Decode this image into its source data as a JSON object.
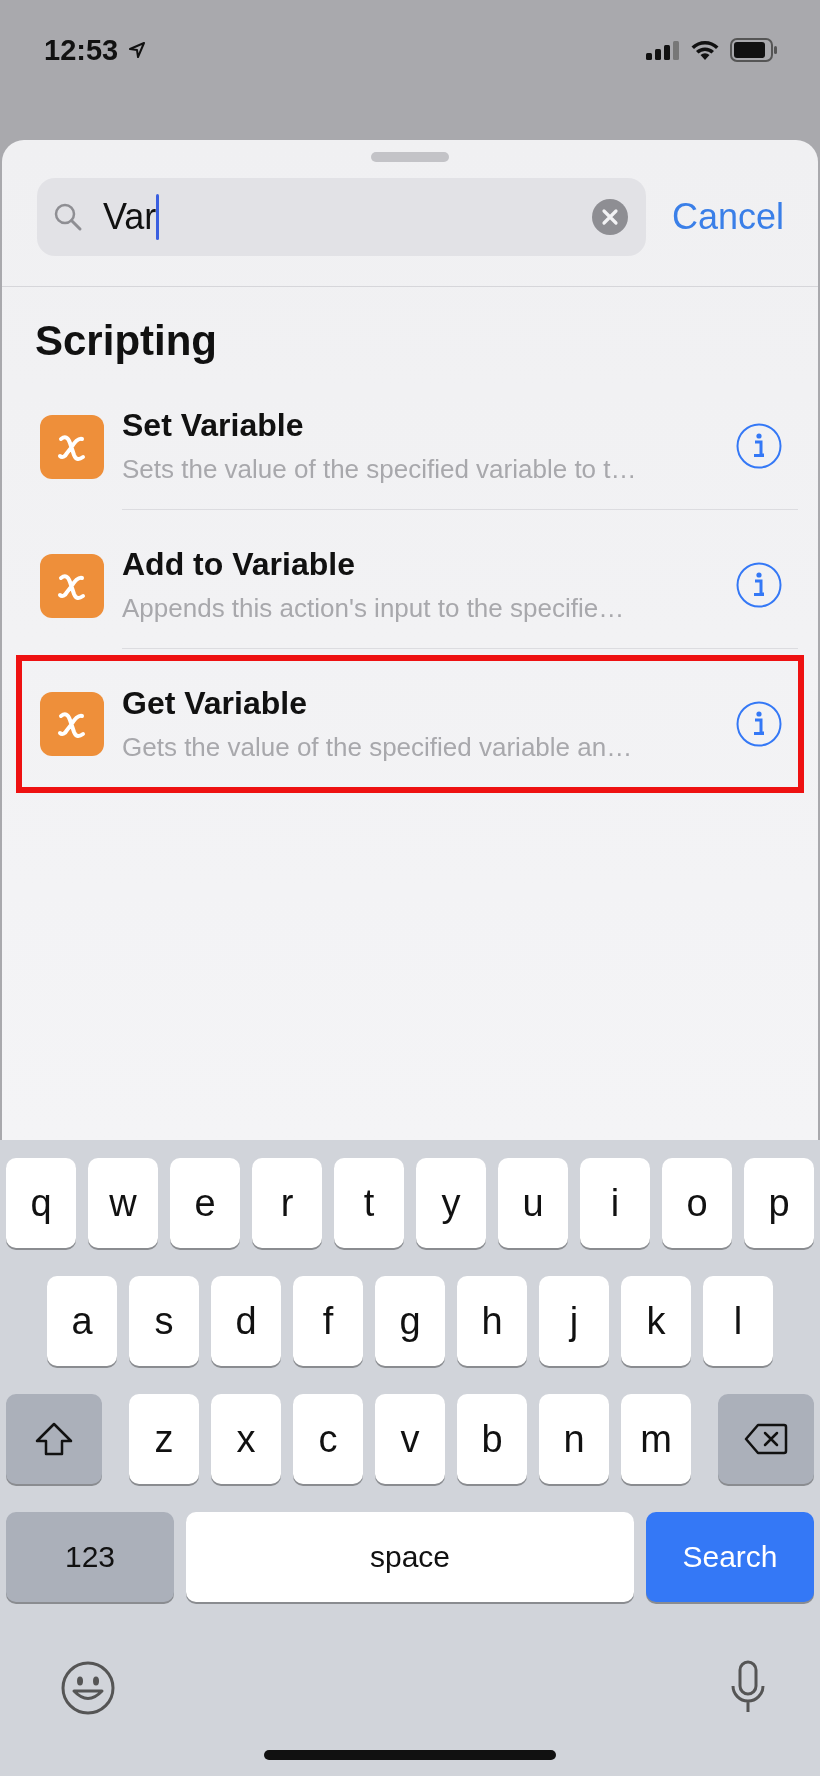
{
  "status_bar": {
    "time": "12:53"
  },
  "search": {
    "value": "Var",
    "cancel": "Cancel"
  },
  "section": {
    "title": "Scripting",
    "items": [
      {
        "title": "Set Variable",
        "subtitle": "Sets the value of the specified variable to t…",
        "highlighted": false
      },
      {
        "title": "Add to Variable",
        "subtitle": "Appends this action's input to the specifie…",
        "highlighted": false
      },
      {
        "title": "Get Variable",
        "subtitle": "Gets the value of the specified variable an…",
        "highlighted": true
      }
    ]
  },
  "keyboard": {
    "rows": [
      [
        "q",
        "w",
        "e",
        "r",
        "t",
        "y",
        "u",
        "i",
        "o",
        "p"
      ],
      [
        "a",
        "s",
        "d",
        "f",
        "g",
        "h",
        "j",
        "k",
        "l"
      ],
      [
        "z",
        "x",
        "c",
        "v",
        "b",
        "n",
        "m"
      ]
    ],
    "numbers": "123",
    "space": "space",
    "search": "Search"
  }
}
